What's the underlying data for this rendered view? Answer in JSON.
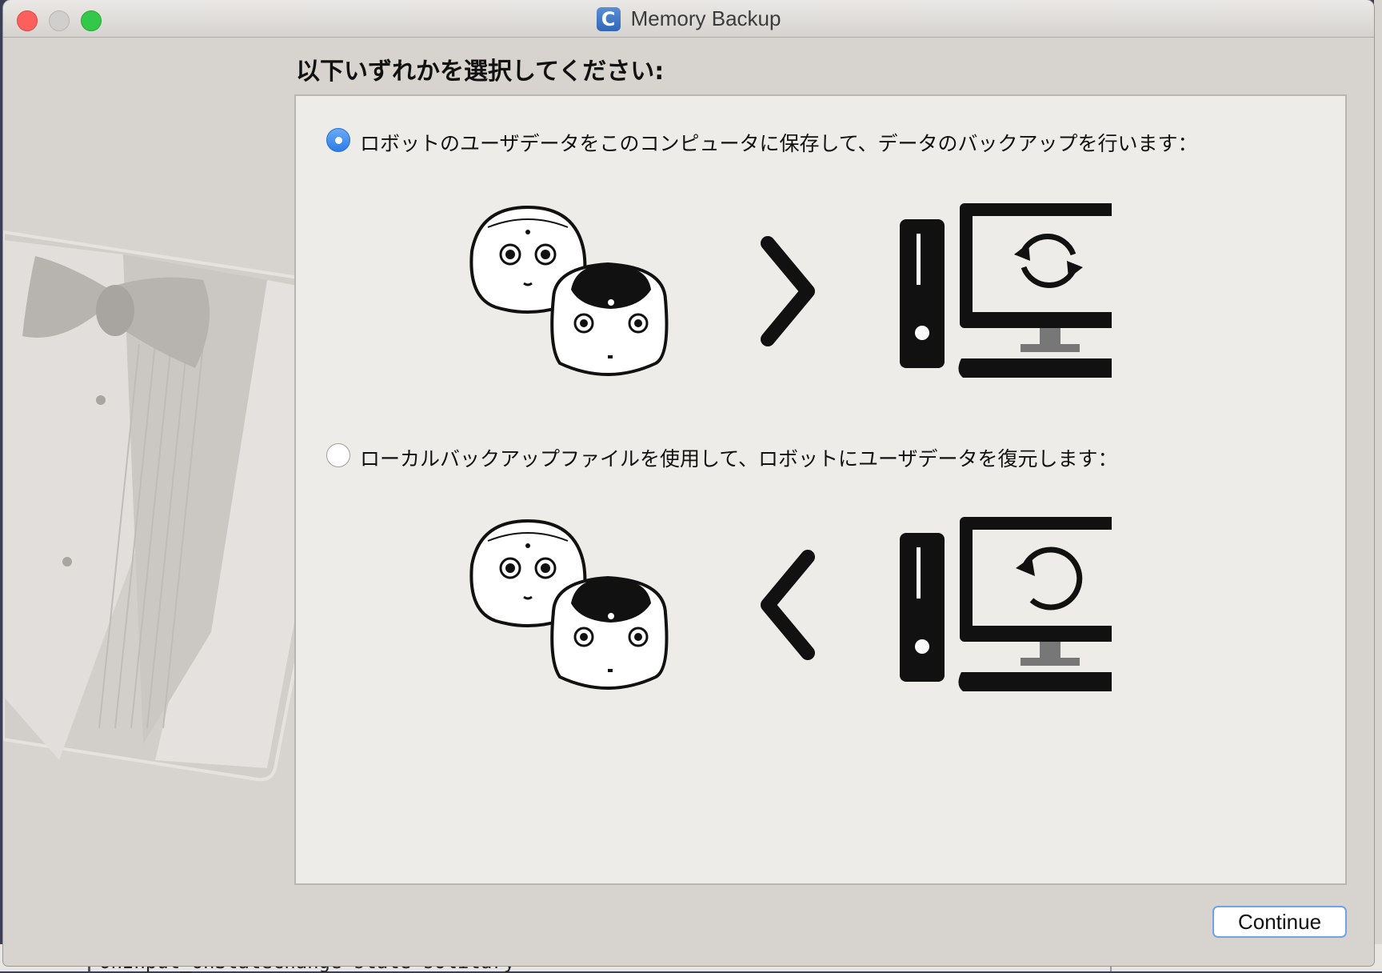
{
  "window": {
    "title": "Memory Backup",
    "app_icon_letter": "C"
  },
  "background": {
    "terminal_text": "onInput_onStateChange state solitary"
  },
  "heading": "以下いずれかを選択してください:",
  "options": [
    {
      "label": "ロボットのユーザデータをこのコンピュータに保存して、データのバックアップを行います：",
      "selected": true,
      "direction": "robot-to-computer"
    },
    {
      "label": "ローカルバックアップファイルを使用して、ロボットにユーザデータを復元します：",
      "selected": false,
      "direction": "computer-to-robot"
    }
  ],
  "buttons": {
    "continue": "Continue"
  },
  "colors": {
    "accent": "#2c7be5",
    "window_bg": "#d7d3ce",
    "panel_bg": "#eeece9"
  }
}
